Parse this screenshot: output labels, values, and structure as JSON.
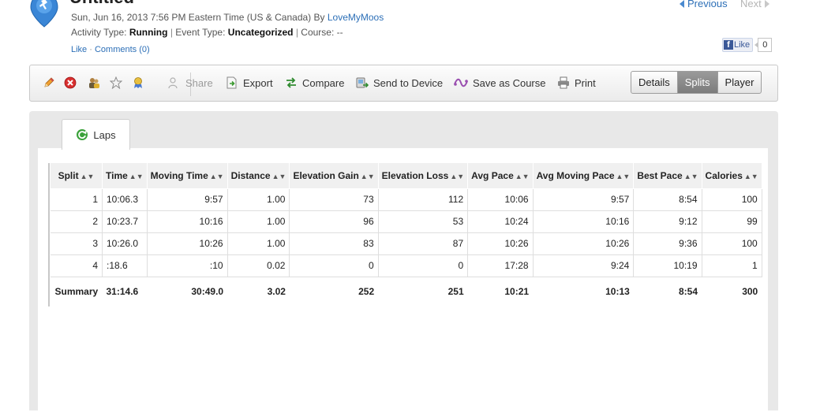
{
  "header": {
    "title": "Untitled",
    "date_line": "Sun, Jun 16, 2013 7:56 PM Eastern Time (US & Canada) By ",
    "owner": "LoveMyMoos",
    "activity_type_label": "Activity Type: ",
    "activity_type": "Running",
    "event_type_label": "Event Type: ",
    "event_type": "Uncategorized",
    "course_label": "Course: ",
    "course": "--",
    "like_label": "Like",
    "comments_label": "Comments (0)",
    "previous_label": "Previous",
    "next_label": "Next",
    "fb_like_label": "Like",
    "fb_count": "0"
  },
  "toolbar": {
    "edit_icon": "pencil-icon",
    "delete_icon": "delete-icon",
    "share_icon": "people-icon",
    "favorite_icon": "star-icon",
    "personal_record_icon": "award-icon",
    "share_label": "Share",
    "export_label": "Export",
    "compare_label": "Compare",
    "send_label": "Send to Device",
    "save_course_label": "Save as Course",
    "print_label": "Print"
  },
  "view_tabs": [
    {
      "label": "Details",
      "active": false
    },
    {
      "label": "Splits",
      "active": true
    },
    {
      "label": "Player",
      "active": false
    }
  ],
  "laps_tab_label": "Laps",
  "table": {
    "columns": [
      "Split",
      "Time",
      "Moving Time",
      "Distance",
      "Elevation Gain",
      "Elevation Loss",
      "Avg Pace",
      "Avg Moving Pace",
      "Best Pace",
      "Calories"
    ],
    "rows": [
      [
        "1",
        "10:06.3",
        "9:57",
        "1.00",
        "73",
        "112",
        "10:06",
        "9:57",
        "8:54",
        "100"
      ],
      [
        "2",
        "10:23.7",
        "10:16",
        "1.00",
        "96",
        "53",
        "10:24",
        "10:16",
        "9:12",
        "99"
      ],
      [
        "3",
        "10:26.0",
        "10:26",
        "1.00",
        "83",
        "87",
        "10:26",
        "10:26",
        "9:36",
        "100"
      ],
      [
        "4",
        ":18.6",
        ":10",
        "0.02",
        "0",
        "0",
        "17:28",
        "9:24",
        "10:19",
        "1"
      ]
    ],
    "summary": [
      "Summary",
      "31:14.6",
      "30:49.0",
      "3.02",
      "252",
      "251",
      "10:21",
      "10:13",
      "8:54",
      "300"
    ]
  },
  "colors": {
    "link": "#2c6fb7",
    "active_tab": "#8a8a8a",
    "panel_bg": "#e8e8e8"
  }
}
